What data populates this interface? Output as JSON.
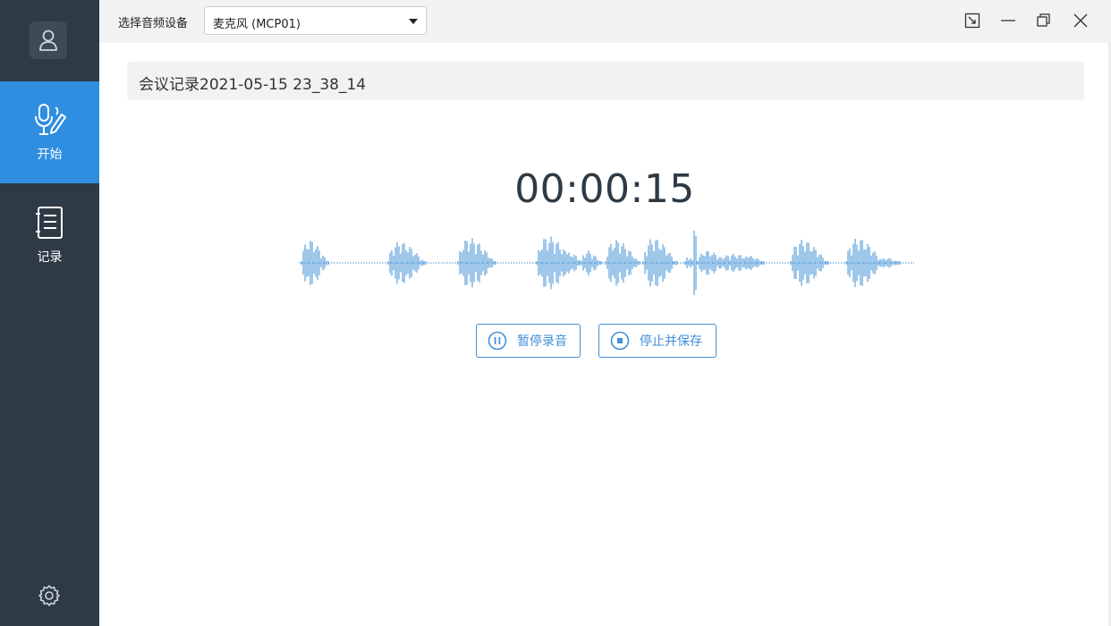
{
  "sidebar": {
    "nav": [
      {
        "label": "开始",
        "icon": "microphone-pen-icon",
        "active": true
      },
      {
        "label": "记录",
        "icon": "notebook-icon",
        "active": false
      }
    ],
    "profile_icon": "user-icon",
    "settings_icon": "gear-icon"
  },
  "topbar": {
    "device_label": "选择音频设备",
    "device_value": "麦克风 (MCP01)"
  },
  "main": {
    "title": "会议记录2021-05-15 23_38_14",
    "timer": "00:00:15",
    "pause_label": "暂停录音",
    "stop_label": "停止并保存"
  },
  "colors": {
    "sidebar_bg": "#2e3a45",
    "accent": "#2f8ee0",
    "wave": "#3f8fd6"
  }
}
